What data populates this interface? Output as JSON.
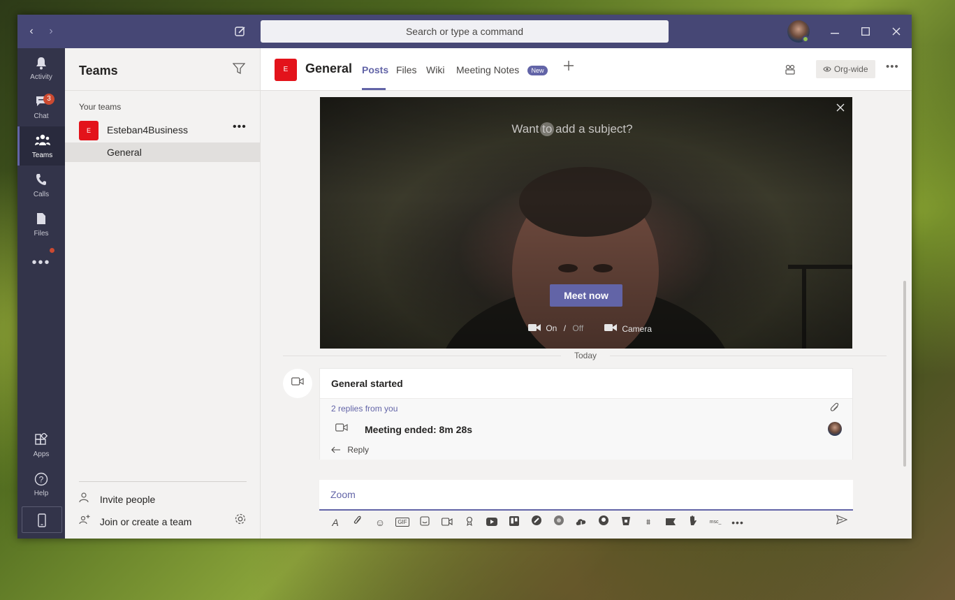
{
  "titlebar": {
    "search_placeholder": "Search or type a command",
    "back_icon": "chevron-left-icon",
    "forward_icon": "chevron-right-icon",
    "compose_icon": "compose-icon",
    "window_controls": [
      "minimize",
      "maximize",
      "close"
    ]
  },
  "rail": {
    "items": [
      {
        "label": "Activity",
        "icon": "bell-icon"
      },
      {
        "label": "Chat",
        "icon": "chat-icon",
        "badge": "3"
      },
      {
        "label": "Teams",
        "icon": "teams-icon"
      },
      {
        "label": "Calls",
        "icon": "phone-icon"
      },
      {
        "label": "Files",
        "icon": "file-icon"
      }
    ],
    "more_icon": "more-icon",
    "bottom": [
      {
        "label": "Apps",
        "icon": "apps-icon"
      },
      {
        "label": "Help",
        "icon": "help-icon"
      }
    ],
    "device_icon": "mobile-icon"
  },
  "sidebar": {
    "title": "Teams",
    "section_label": "Your teams",
    "team": {
      "initial": "E",
      "name": "Esteban4Business"
    },
    "channel": "General",
    "invite_label": "Invite people",
    "join_label": "Join or create a team"
  },
  "header": {
    "initial": "E",
    "title": "General",
    "tabs": [
      "Posts",
      "Files",
      "Wiki",
      "Meeting Notes"
    ],
    "new_badge": "New",
    "orgwide_label": "Org-wide"
  },
  "meeting_preview": {
    "subject_placeholder": "Want to add a subject?",
    "meet_now_label": "Meet now",
    "video_on": "On",
    "video_sep": "/",
    "video_off": "Off",
    "camera_label": "Camera"
  },
  "feed": {
    "date_divider": "Today",
    "post": {
      "title": "General started",
      "replies_link": "2 replies from you",
      "meeting_text": "Meeting ended: 8m 28s",
      "reply_label": "Reply"
    }
  },
  "compose": {
    "text": "Zoom"
  },
  "colors": {
    "titlebar": "#464775",
    "rail": "#33344a",
    "accent": "#6264a7",
    "team_tile": "#e3131b",
    "badge": "#cc4a31"
  }
}
